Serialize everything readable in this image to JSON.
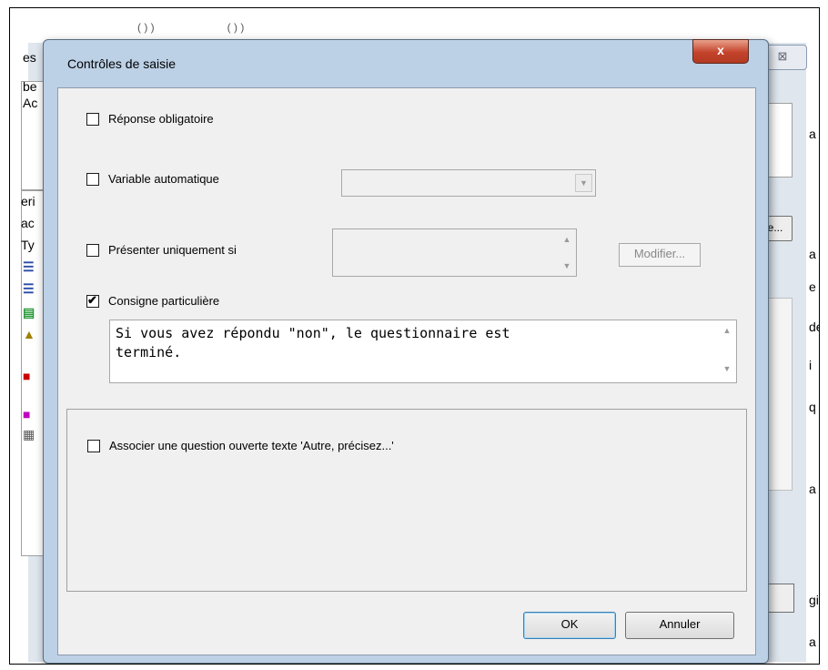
{
  "dialog": {
    "title": "Contrôles de saisie",
    "close_label": "x"
  },
  "options": {
    "required": {
      "label": "Réponse obligatoire",
      "checked": false
    },
    "auto_variable": {
      "label": "Variable automatique",
      "checked": false,
      "value": ""
    },
    "present_only_if": {
      "label": "Présenter uniquement si",
      "checked": false,
      "modify_label": "Modifier..."
    },
    "special_instruction": {
      "label": "Consigne particulière",
      "checked": true,
      "text": "Si vous avez répondu \"non\", le questionnaire est\nterminé."
    },
    "open_question": {
      "label": "Associer une question ouverte texte 'Autre, précisez...'",
      "checked": false
    }
  },
  "buttons": {
    "ok": "OK",
    "cancel": "Annuler"
  },
  "background": {
    "fragments": [
      "es",
      "be",
      "Ac",
      "eri",
      "ac",
      "Ty",
      "a",
      "e...",
      "a",
      "e",
      "de",
      "i",
      "q",
      "a",
      "gi",
      "a"
    ],
    "close_glyph": "⊠"
  },
  "icons": {
    "check": "✔",
    "dropdown": "▼",
    "up": "▲",
    "down": "▼"
  },
  "colors": {
    "dialog_frame": "#bcd0e6",
    "close_button": "#c4422b",
    "client": "#f0f0f0"
  }
}
